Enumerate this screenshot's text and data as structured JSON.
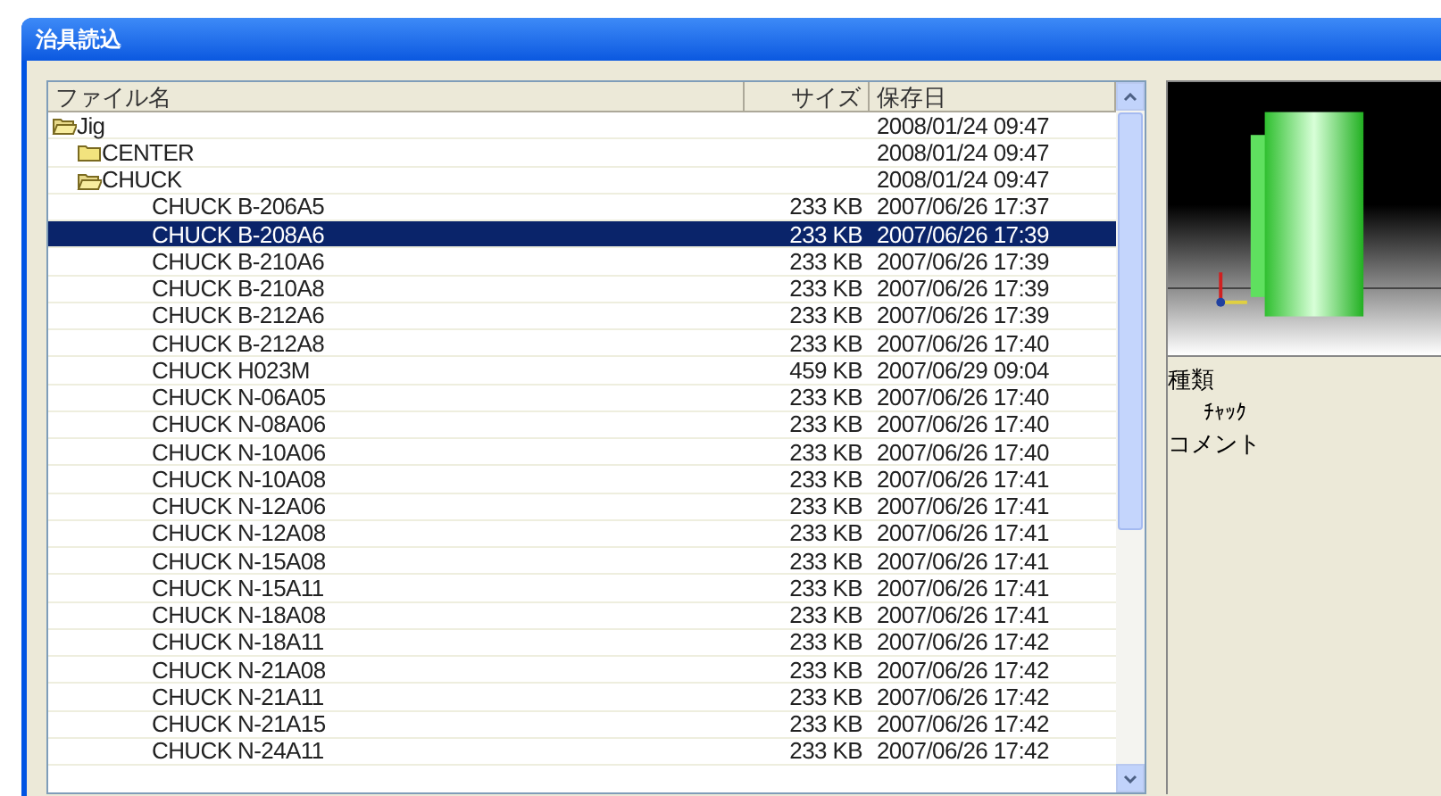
{
  "window": {
    "title": "治具読込"
  },
  "table": {
    "columns": [
      "ファイル名",
      "サイズ",
      "保存日"
    ],
    "tree": [
      {
        "kind": "folder",
        "name": "Jig",
        "expanded": true,
        "date": "2008/01/24 09:47",
        "selected": false,
        "children": [
          {
            "kind": "folder",
            "name": "CENTER",
            "expanded": false,
            "date": "2008/01/24 09:47",
            "selected": false
          },
          {
            "kind": "folder",
            "name": "CHUCK",
            "expanded": true,
            "date": "2008/01/24 09:47",
            "selected": false,
            "children": [
              {
                "kind": "file",
                "name": "CHUCK B-206A5",
                "size": "233 KB",
                "date": "2007/06/26 17:37",
                "selected": false
              },
              {
                "kind": "file",
                "name": "CHUCK B-208A6",
                "size": "233 KB",
                "date": "2007/06/26 17:39",
                "selected": true
              },
              {
                "kind": "file",
                "name": "CHUCK B-210A6",
                "size": "233 KB",
                "date": "2007/06/26 17:39",
                "selected": false
              },
              {
                "kind": "file",
                "name": "CHUCK B-210A8",
                "size": "233 KB",
                "date": "2007/06/26 17:39",
                "selected": false
              },
              {
                "kind": "file",
                "name": "CHUCK B-212A6",
                "size": "233 KB",
                "date": "2007/06/26 17:39",
                "selected": false
              },
              {
                "kind": "file",
                "name": "CHUCK B-212A8",
                "size": "233 KB",
                "date": "2007/06/26 17:40",
                "selected": false
              },
              {
                "kind": "file",
                "name": "CHUCK H023M",
                "size": "459 KB",
                "date": "2007/06/29 09:04",
                "selected": false
              },
              {
                "kind": "file",
                "name": "CHUCK N-06A05",
                "size": "233 KB",
                "date": "2007/06/26 17:40",
                "selected": false
              },
              {
                "kind": "file",
                "name": "CHUCK N-08A06",
                "size": "233 KB",
                "date": "2007/06/26 17:40",
                "selected": false
              },
              {
                "kind": "file",
                "name": "CHUCK N-10A06",
                "size": "233 KB",
                "date": "2007/06/26 17:40",
                "selected": false
              },
              {
                "kind": "file",
                "name": "CHUCK N-10A08",
                "size": "233 KB",
                "date": "2007/06/26 17:41",
                "selected": false
              },
              {
                "kind": "file",
                "name": "CHUCK N-12A06",
                "size": "233 KB",
                "date": "2007/06/26 17:41",
                "selected": false
              },
              {
                "kind": "file",
                "name": "CHUCK N-12A08",
                "size": "233 KB",
                "date": "2007/06/26 17:41",
                "selected": false
              },
              {
                "kind": "file",
                "name": "CHUCK N-15A08",
                "size": "233 KB",
                "date": "2007/06/26 17:41",
                "selected": false
              },
              {
                "kind": "file",
                "name": "CHUCK N-15A11",
                "size": "233 KB",
                "date": "2007/06/26 17:41",
                "selected": false
              },
              {
                "kind": "file",
                "name": "CHUCK N-18A08",
                "size": "233 KB",
                "date": "2007/06/26 17:41",
                "selected": false
              },
              {
                "kind": "file",
                "name": "CHUCK N-18A11",
                "size": "233 KB",
                "date": "2007/06/26 17:42",
                "selected": false
              },
              {
                "kind": "file",
                "name": "CHUCK N-21A08",
                "size": "233 KB",
                "date": "2007/06/26 17:42",
                "selected": false
              },
              {
                "kind": "file",
                "name": "CHUCK N-21A11",
                "size": "233 KB",
                "date": "2007/06/26 17:42",
                "selected": false
              },
              {
                "kind": "file",
                "name": "CHUCK N-21A15",
                "size": "233 KB",
                "date": "2007/06/26 17:42",
                "selected": false
              },
              {
                "kind": "file",
                "name": "CHUCK N-24A11",
                "size": "233 KB",
                "date": "2007/06/26 17:42",
                "selected": false
              }
            ]
          }
        ]
      }
    ]
  },
  "details": {
    "type_label": "種類",
    "type_value": "ﾁｬｯｸ",
    "comment_label": "コメント"
  }
}
